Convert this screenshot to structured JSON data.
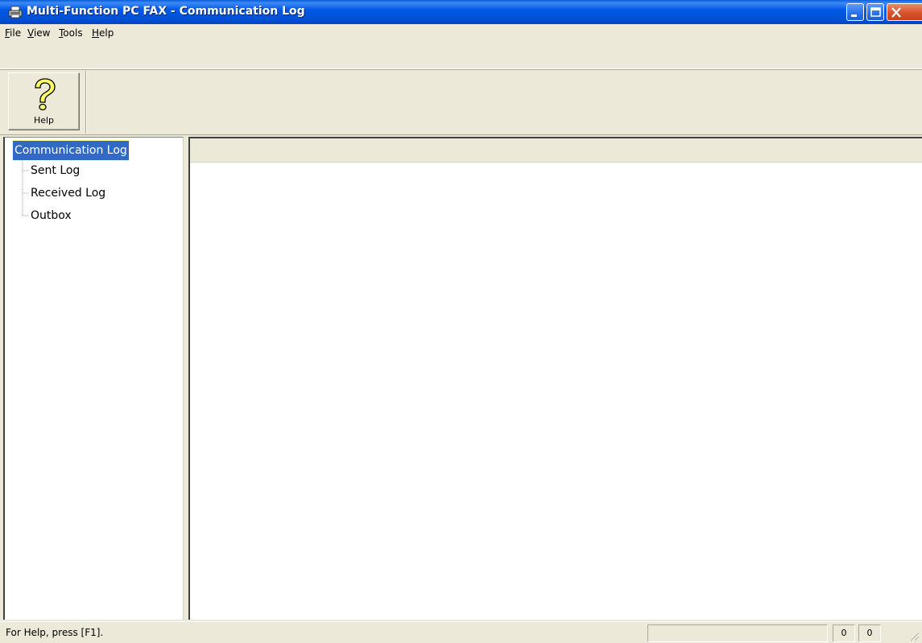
{
  "window": {
    "title": "Multi-Function PC FAX - Communication Log",
    "icon": "fax-printer-icon"
  },
  "menu": {
    "items": [
      {
        "label_first": "F",
        "label_rest": "ile"
      },
      {
        "label_first": "V",
        "label_rest": "iew"
      },
      {
        "label_first": "T",
        "label_rest": "ools"
      },
      {
        "label_first": "H",
        "label_rest": "elp"
      }
    ]
  },
  "toolbar": {
    "help_label": "Help",
    "help_icon": "question-mark-icon"
  },
  "tree": {
    "root": "Communication Log",
    "children": [
      "Sent Log",
      "Received Log",
      "Outbox"
    ]
  },
  "status": {
    "help_text": "For Help, press [F1].",
    "count1": "0",
    "count2": "0"
  },
  "colors": {
    "titlebar": "#0054e3",
    "selection": "#316ac5",
    "chrome": "#ece9d8",
    "close_button": "#d8542a"
  }
}
